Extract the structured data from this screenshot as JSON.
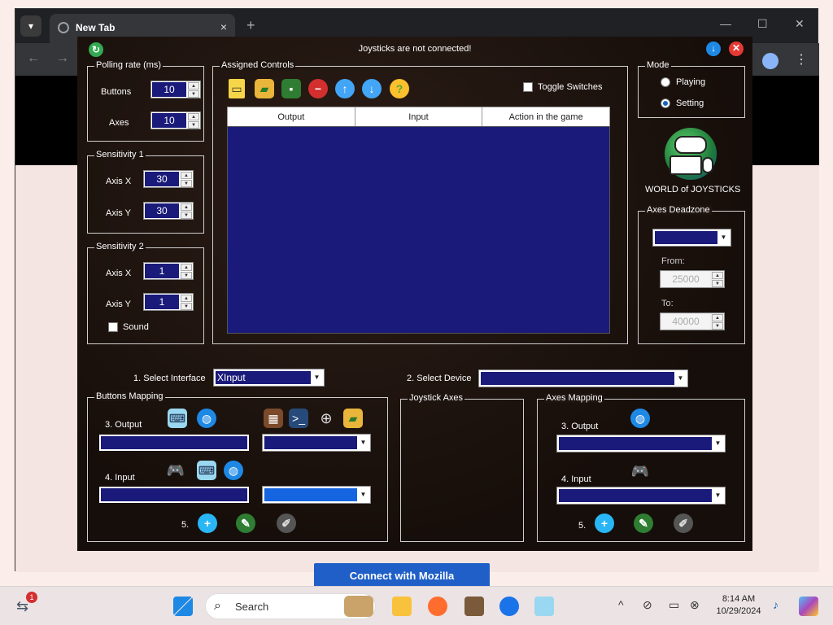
{
  "browser": {
    "tab_title": "New Tab",
    "tab_close": "×",
    "new_tab": "+",
    "minimize": "—",
    "maximize": "☐",
    "close": "✕",
    "back": "←",
    "forward": "→",
    "menu": "⋮",
    "page_button": "Connect with Mozilla"
  },
  "app": {
    "title": "Joysticks are not connected!",
    "polling": {
      "label": "Polling rate (ms)",
      "buttons_label": "Buttons",
      "buttons_value": "10",
      "axes_label": "Axes",
      "axes_value": "10"
    },
    "sensitivity1": {
      "label": "Sensitivity 1",
      "axis_x_label": "Axis X",
      "axis_x_value": "30",
      "axis_y_label": "Axis Y",
      "axis_y_value": "30"
    },
    "sensitivity2": {
      "label": "Sensitivity 2",
      "axis_x_label": "Axis X",
      "axis_x_value": "1",
      "axis_y_label": "Axis Y",
      "axis_y_value": "1",
      "sound_label": "Sound"
    },
    "assigned_controls": {
      "label": "Assigned Controls",
      "toggle_switches": "Toggle Switches",
      "columns": [
        "Output",
        "Input",
        "Action in the game"
      ]
    },
    "mode": {
      "label": "Mode",
      "options": [
        "Playing",
        "Setting"
      ],
      "selected": "Setting"
    },
    "logo_caption": "WORLD of JOYSTICKS",
    "deadzone": {
      "label": "Axes Deadzone",
      "from_label": "From:",
      "from_value": "25000",
      "to_label": "To:",
      "to_value": "40000"
    },
    "select_interface": {
      "label": "1. Select Interface",
      "value": "XInput"
    },
    "select_device": {
      "label": "2. Select Device",
      "value": ""
    },
    "buttons_mapping": {
      "label": "Buttons Mapping",
      "output_label": "3. Output",
      "input_label": "4. Input",
      "step5_label": "5."
    },
    "joystick_axes": {
      "label": "Joystick Axes"
    },
    "axes_mapping": {
      "label": "Axes Mapping",
      "output_label": "3. Output",
      "input_label": "4. Input",
      "step5_label": "5."
    }
  },
  "taskbar": {
    "search_placeholder": "Search",
    "notification_count": "1",
    "time": "8:14 AM",
    "date": "10/29/2024"
  }
}
